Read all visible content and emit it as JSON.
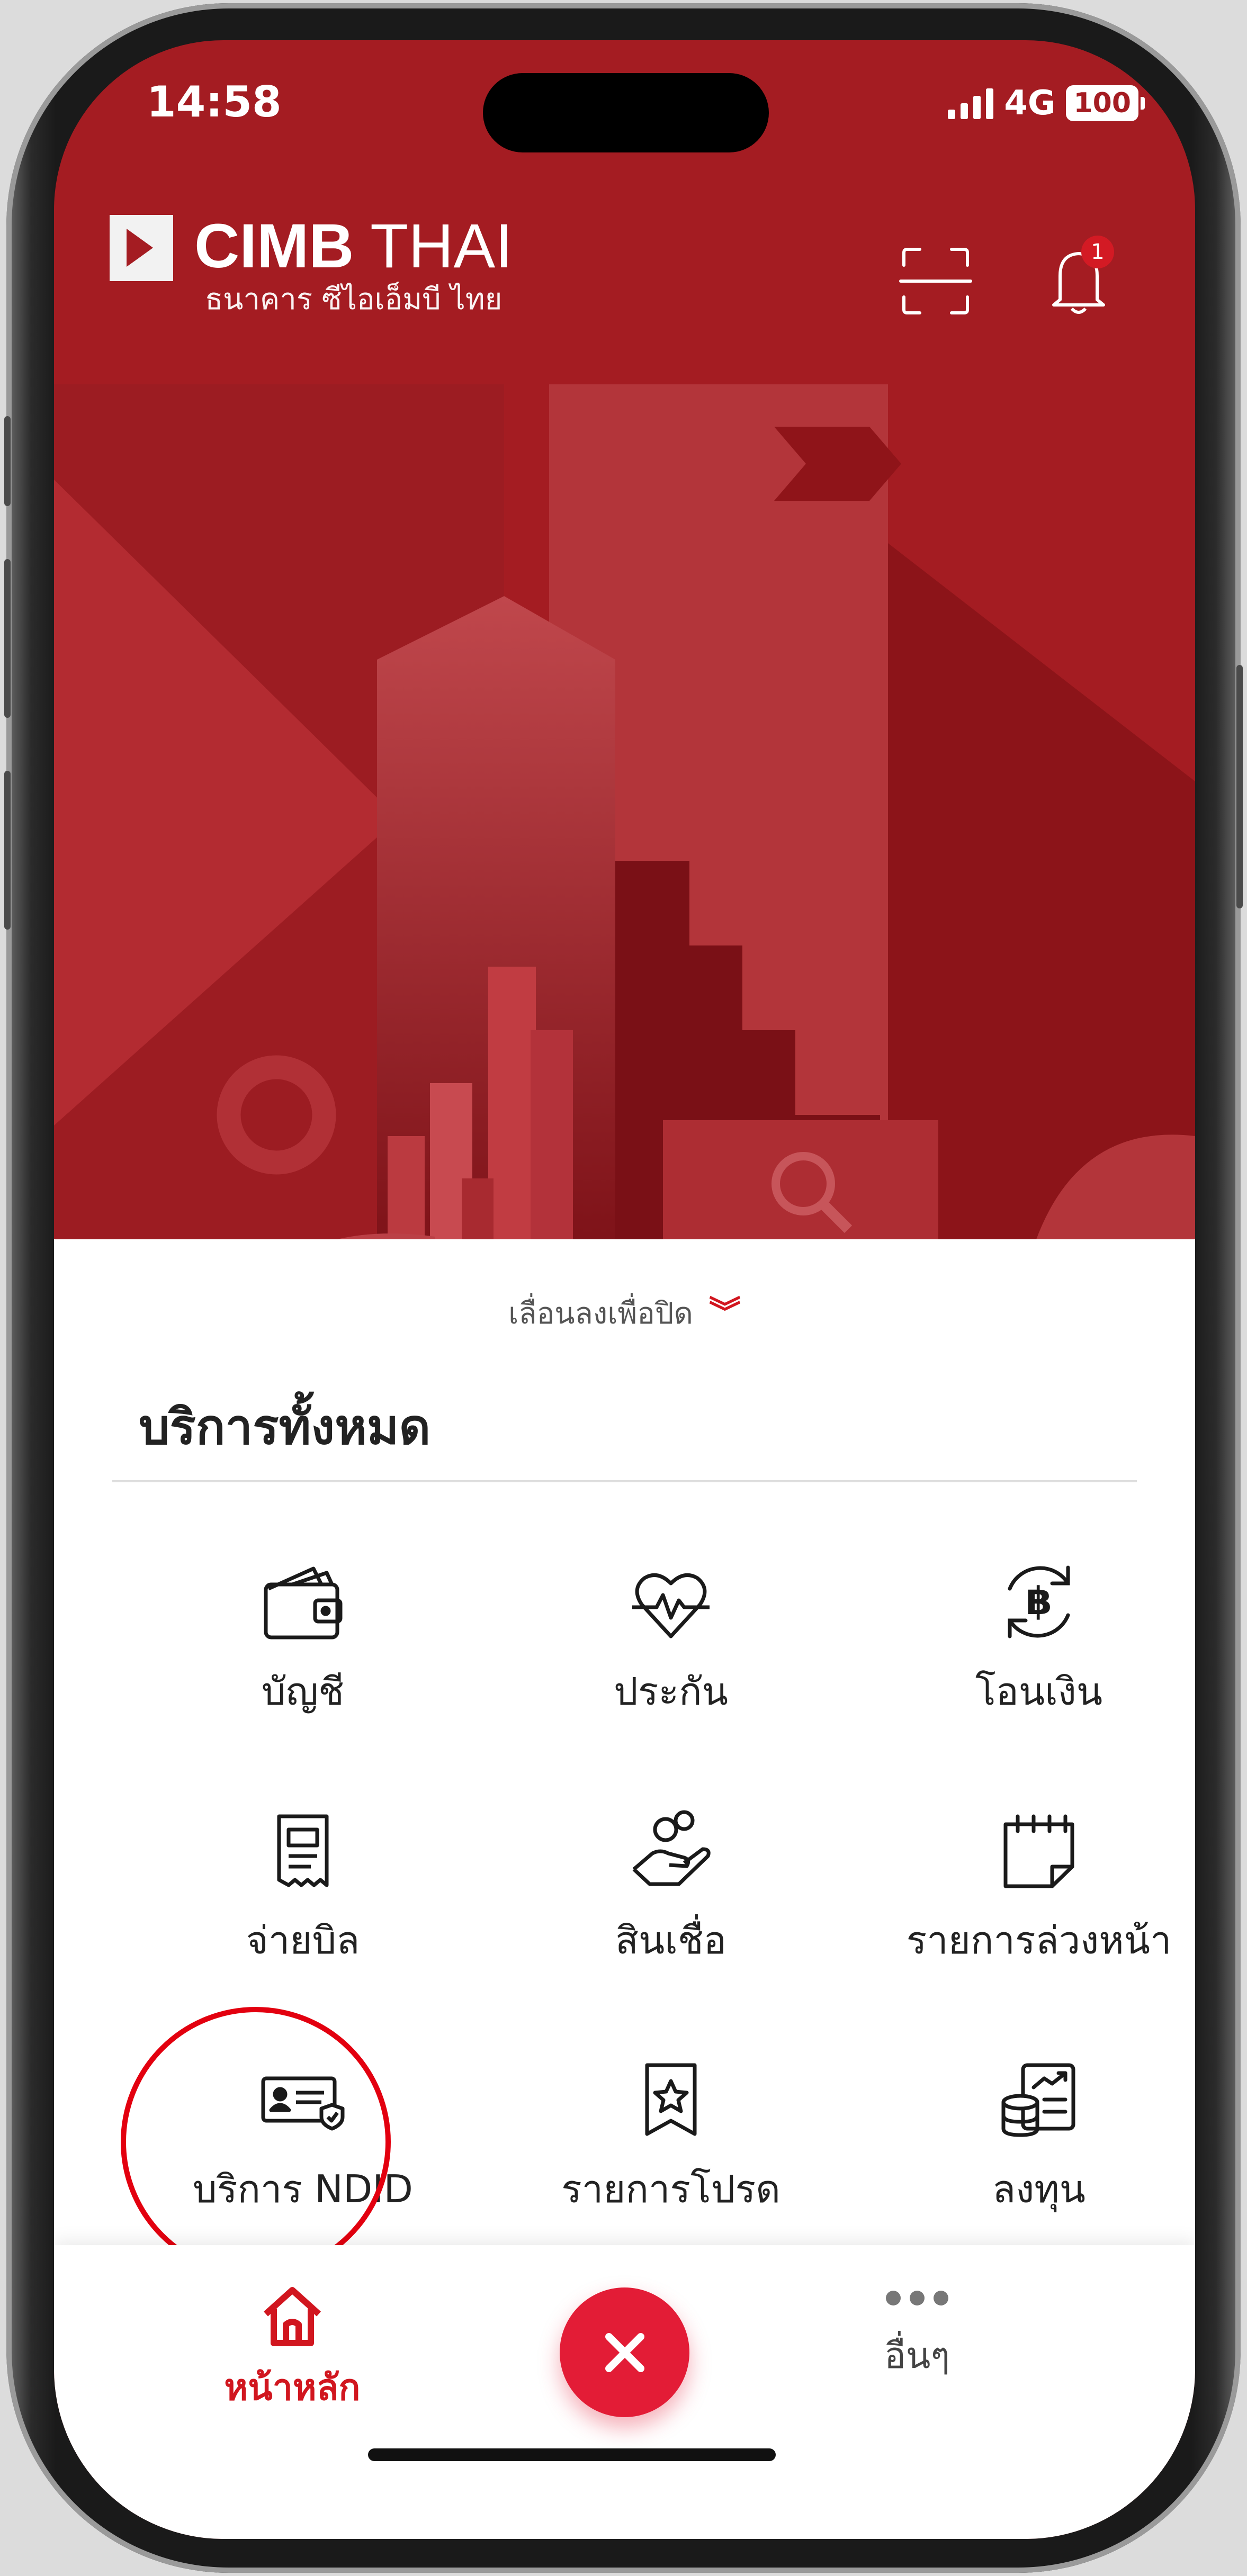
{
  "status_bar": {
    "time": "14:58",
    "network": "4G",
    "battery": "100"
  },
  "header": {
    "logo_main_bold": "CIMB",
    "logo_main_light": "THAI",
    "logo_sub": "ธนาคาร ซีไอเอ็มบี ไทย",
    "notification_count": "1"
  },
  "sheet": {
    "close_hint": "เลื่อนลงเพื่อปิด",
    "title": "บริการทั้งหมด",
    "items": [
      {
        "label": "บัญชี",
        "icon": "wallet-icon"
      },
      {
        "label": "ประกัน",
        "icon": "heart-shield-icon"
      },
      {
        "label": "โอนเงิน",
        "icon": "baht-transfer-icon"
      },
      {
        "label": "จ่ายบิล",
        "icon": "bill-icon"
      },
      {
        "label": "สินเชื่อ",
        "icon": "hand-coins-icon"
      },
      {
        "label": "รายการล่วงหน้า",
        "icon": "calendar-icon"
      },
      {
        "label": "บริการ NDID",
        "icon": "id-card-icon"
      },
      {
        "label": "รายการโปรด",
        "icon": "favorite-bookmark-icon"
      },
      {
        "label": "ลงทุน",
        "icon": "investment-icon"
      }
    ]
  },
  "bottom_nav": {
    "home_label": "หน้าหลัก",
    "more_label": "อื่นๆ"
  },
  "colors": {
    "brand_red": "#a41c22",
    "accent_red": "#e31c36",
    "highlight_circle": "#e3000f"
  }
}
